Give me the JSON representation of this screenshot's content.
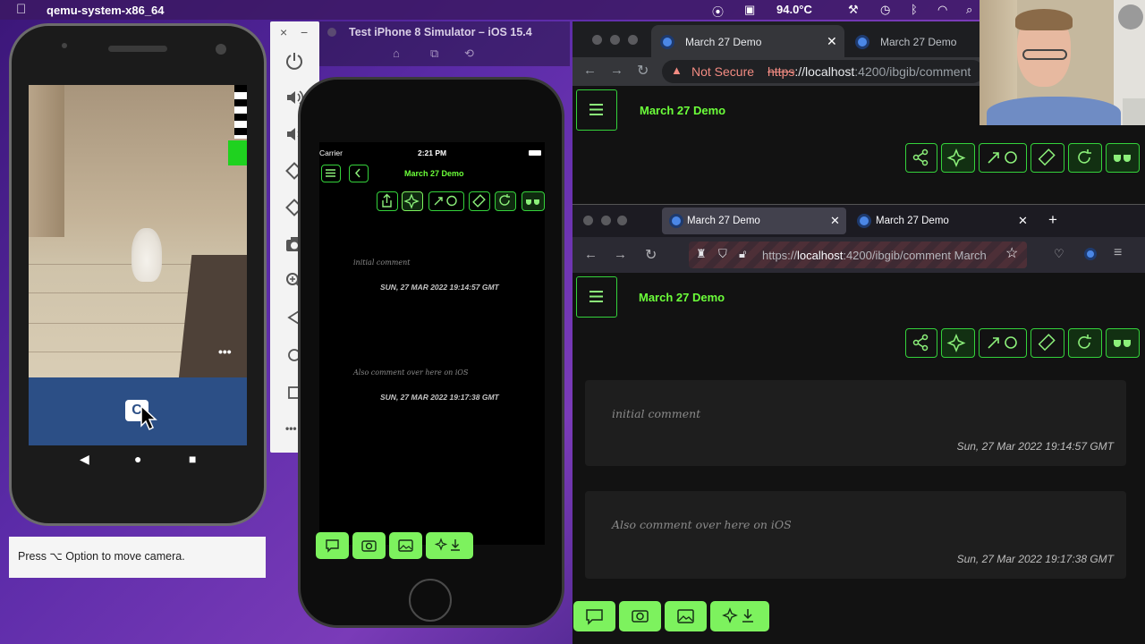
{
  "menubar": {
    "app_name": "qemu-system-x86_64",
    "temperature": "94.0°C"
  },
  "android": {
    "hint": "Press ⌥ Option to move camera.",
    "more": "•••",
    "nav": [
      "◀",
      "●",
      "■"
    ]
  },
  "emulator": {
    "close": "×",
    "minimize": "−",
    "more": "•••"
  },
  "simulator": {
    "window_title": "Test iPhone 8 Simulator – iOS 15.4",
    "carrier": "Carrier",
    "time": "2:21 PM",
    "app_title": "March 27 Demo",
    "comments": [
      {
        "text": "initial comment",
        "date": "SUN, 27 MAR 2022 19:14:57 GMT"
      },
      {
        "text": "Also comment over here on iOS",
        "date": "SUN, 27 MAR 2022 19:17:38 GMT"
      }
    ]
  },
  "chrome": {
    "tabs": [
      {
        "label": "March 27 Demo"
      },
      {
        "label": "March 27 Demo"
      }
    ],
    "not_secure": "Not Secure",
    "url_scheme": "https",
    "url_host": "://localhost",
    "url_rest": ":4200/ibgib/comment",
    "app_title": "March 27 Demo"
  },
  "firefox": {
    "tabs": [
      {
        "label": "March 27 Demo"
      },
      {
        "label": "March 27 Demo"
      }
    ],
    "url_scheme": "https://",
    "url_host": "localhost",
    "url_rest": ":4200/ibgib/comment March",
    "app_title": "March 27 Demo",
    "comments": [
      {
        "text": "initial comment",
        "date": "Sun, 27 Mar 2022 19:14:57 GMT"
      },
      {
        "text": "Also comment over here on iOS",
        "date": "Sun, 27 Mar 2022 19:17:38 GMT"
      }
    ]
  },
  "colors": {
    "accent_green": "#7df25e",
    "outline_green": "#34d23b",
    "title_green": "#6cff3a"
  }
}
